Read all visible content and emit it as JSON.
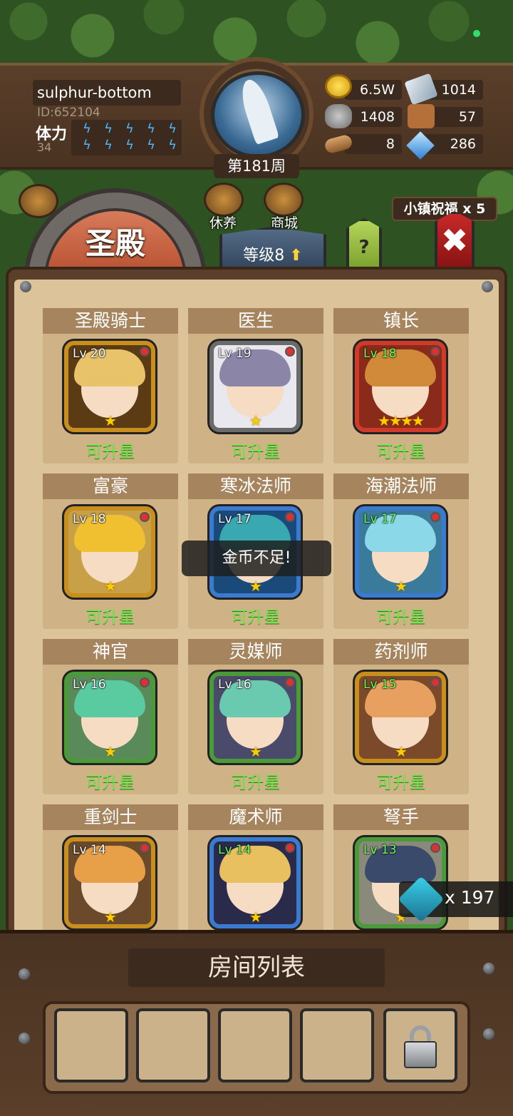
{
  "player": {
    "name": "sulphur-bottom",
    "id": "ID:652104",
    "stamina_label": "体力",
    "stamina_value": "34",
    "stamina_bolts": 10
  },
  "week": "第181周",
  "resources": {
    "gold": "6.5W",
    "steel": "1014",
    "stone": "1408",
    "leather": "57",
    "wood": "8",
    "crystal": "286"
  },
  "buildings": [
    "休养",
    "商城"
  ],
  "blessing": "小镇祝福 x 5",
  "page_title": "圣殿",
  "level_tab": "等级8",
  "help_label": "?",
  "close_label": "✖",
  "heroes": [
    {
      "name": "圣殿骑士",
      "lv": "Lv 20",
      "stars": "★",
      "status": "可升星",
      "frame": "#c98f1e",
      "hair": "#e8c36a",
      "bg": "#5a3b14",
      "lv_green": false
    },
    {
      "name": "医生",
      "lv": "Lv 19",
      "stars": "★",
      "status": "可升星",
      "frame": "#6b6b6b",
      "hair": "#8b85a8",
      "bg": "#e8e8ee",
      "lv_green": false
    },
    {
      "name": "镇长",
      "lv": "Lv 18",
      "stars": "★★★★",
      "status": "可升星",
      "frame": "#d03a2a",
      "hair": "#d08a3a",
      "bg": "#8a2a1a",
      "lv_green": true
    },
    {
      "name": "富豪",
      "lv": "Lv 18",
      "stars": "★",
      "status": "可升星",
      "frame": "#c98f1e",
      "hair": "#f0c030",
      "bg": "#c8a048",
      "lv_green": false
    },
    {
      "name": "寒冰法师",
      "lv": "Lv 17",
      "stars": "★",
      "status": "可升星",
      "frame": "#3a7ad0",
      "hair": "#3aa8b0",
      "bg": "#1a4a7a",
      "lv_green": false
    },
    {
      "name": "海潮法师",
      "lv": "Lv 17",
      "stars": "★",
      "status": "可升星",
      "frame": "#3a7ad0",
      "hair": "#8ad8e8",
      "bg": "#3a7a9a",
      "lv_green": true
    },
    {
      "name": "神官",
      "lv": "Lv 16",
      "stars": "★",
      "status": "可升星",
      "frame": "#4a9a3a",
      "hair": "#5acaa0",
      "bg": "#5a8a5a",
      "lv_green": false
    },
    {
      "name": "灵媒师",
      "lv": "Lv 16",
      "stars": "★",
      "status": "可升星",
      "frame": "#4a9a3a",
      "hair": "#6acab0",
      "bg": "#4a4a6a",
      "lv_green": false
    },
    {
      "name": "药剂师",
      "lv": "Lv 15",
      "stars": "★",
      "status": "可升星",
      "frame": "#c98f1e",
      "hair": "#e8a060",
      "bg": "#7a4a2a",
      "lv_green": true
    },
    {
      "name": "重剑士",
      "lv": "Lv 14",
      "stars": "★",
      "status": "",
      "frame": "#c98f1e",
      "hair": "#e8a048",
      "bg": "#6a4a2a",
      "lv_green": false
    },
    {
      "name": "魔术师",
      "lv": "Lv 14",
      "stars": "★",
      "status": "",
      "frame": "#3a7ad0",
      "hair": "#e8c060",
      "bg": "#2a2a4a",
      "lv_green": true
    },
    {
      "name": "弩手",
      "lv": "Lv 13",
      "stars": "★",
      "status": "",
      "frame": "#4a9a3a",
      "hair": "#3a4a6a",
      "bg": "#8a8a7a",
      "lv_green": true
    }
  ],
  "toast": "金币不足!",
  "gem_count": "x 197",
  "room_list_title": "房间列表",
  "room_slots": 4
}
